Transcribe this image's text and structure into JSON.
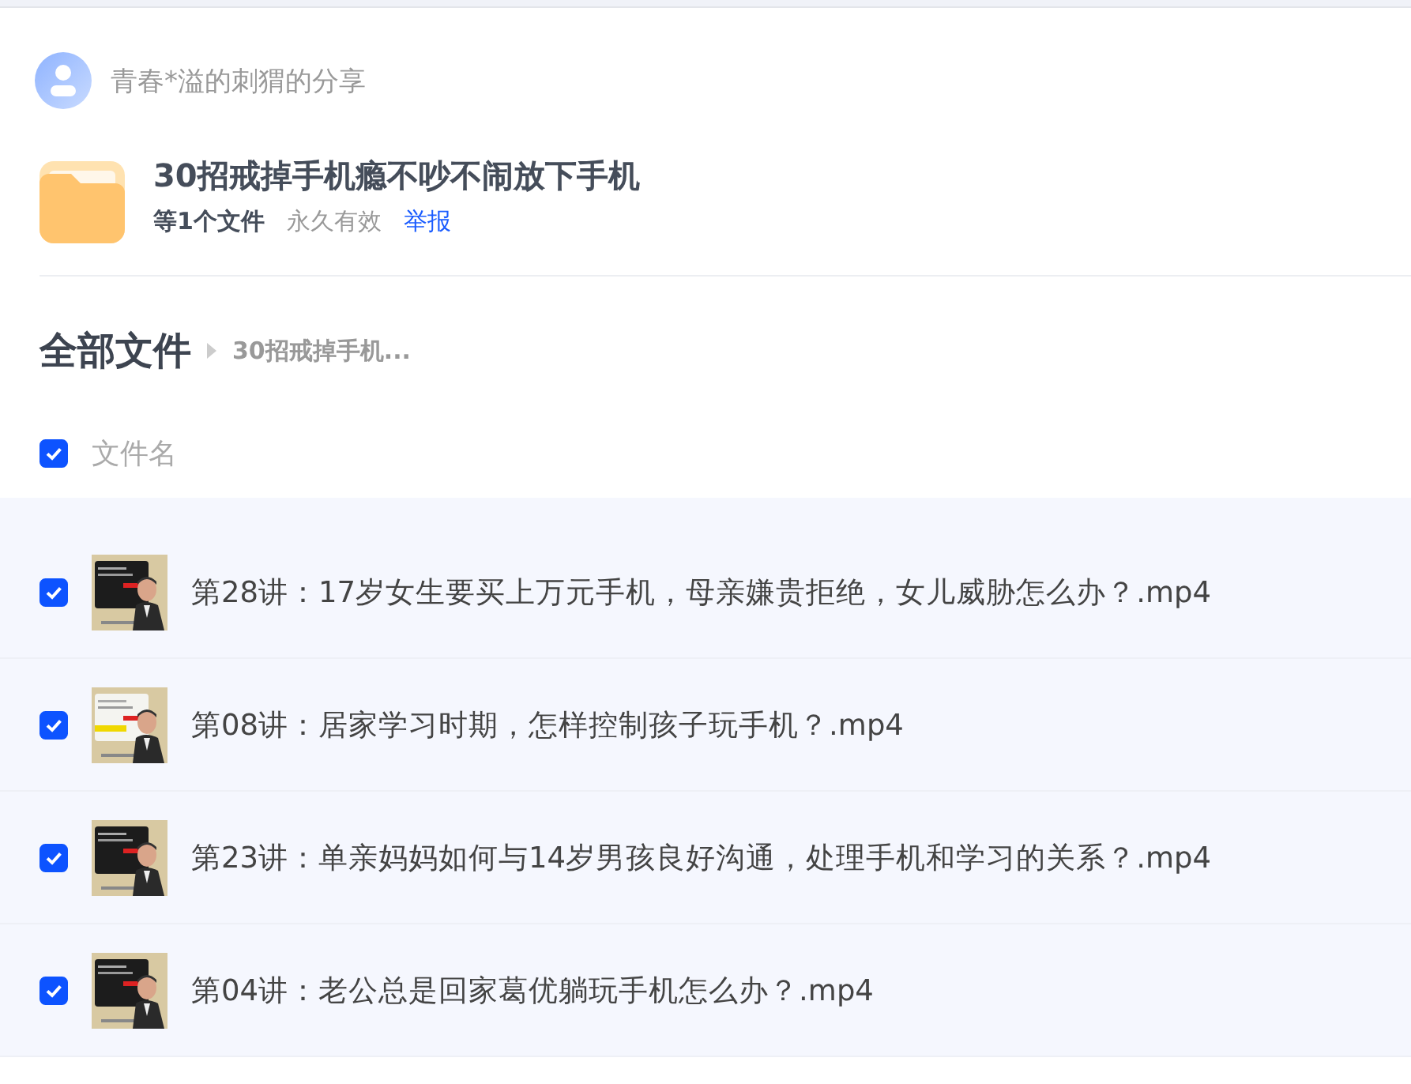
{
  "sharer": {
    "name": "青春*溢的刺猬的分享"
  },
  "share": {
    "title": "30招戒掉手机瘾不吵不闹放下手机",
    "file_count": "等1个文件",
    "validity": "永久有效",
    "report_link": "举报"
  },
  "breadcrumb": {
    "root": "全部文件",
    "current": "30招戒掉手机..."
  },
  "list_header": {
    "label": "文件名",
    "checked": true
  },
  "files": [
    {
      "name": "第28讲：17岁女生要买上万元手机，母亲嫌贵拒绝，女儿威胁怎么办？.mp4",
      "checked": true
    },
    {
      "name": "第08讲：居家学习时期，怎样控制孩子玩手机？.mp4",
      "checked": true
    },
    {
      "name": "第23讲：单亲妈妈如何与14岁男孩良好沟通，处理手机和学习的关系？.mp4",
      "checked": true
    },
    {
      "name": "第04讲：老公总是回家葛优躺玩手机怎么办？.mp4",
      "checked": true
    }
  ]
}
